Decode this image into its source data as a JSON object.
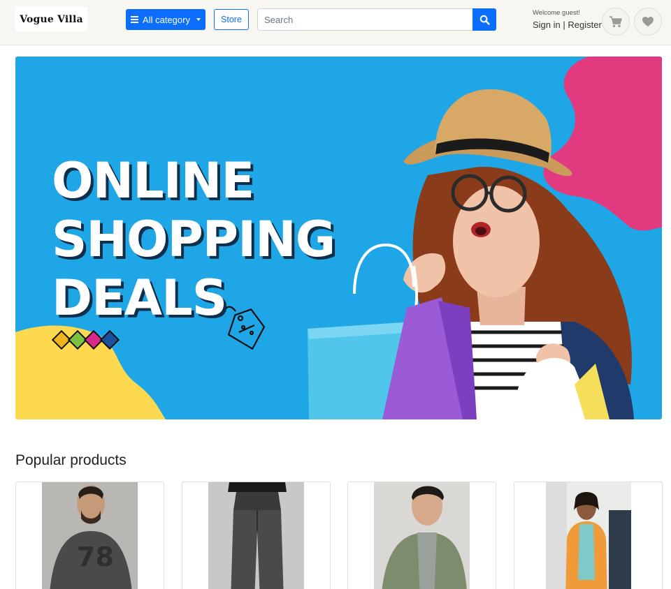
{
  "header": {
    "logo_text": "Vogue Villa",
    "category_label": "All category",
    "store_label": "Store",
    "search_placeholder": "Search",
    "welcome_text": "Welcome guest!",
    "sign_in_label": "Sign in",
    "separator": " | ",
    "register_label": "Register",
    "icons": [
      "menu-icon",
      "caret-down-icon",
      "search-icon",
      "cart-icon",
      "heart-icon"
    ]
  },
  "banner": {
    "lines": [
      "ONLINE",
      "SHOPPING",
      "DEALS"
    ],
    "colors": {
      "background": "#1fa6e6",
      "pink_blob": "#e23a7f",
      "yellow_blob": "#fcd94f",
      "diamonds": [
        "#f2b320",
        "#7cc142",
        "#d9278a",
        "#1c4f9c"
      ]
    }
  },
  "popular": {
    "title": "Popular products",
    "products": [
      {
        "alt": "man-grey-tshirt"
      },
      {
        "alt": "woman-black-jeans"
      },
      {
        "alt": "man-green-jacket"
      },
      {
        "alt": "woman-orange-blazer"
      }
    ]
  },
  "colors": {
    "primary": "#0d6efd",
    "header_bg": "#f7f6f1"
  }
}
